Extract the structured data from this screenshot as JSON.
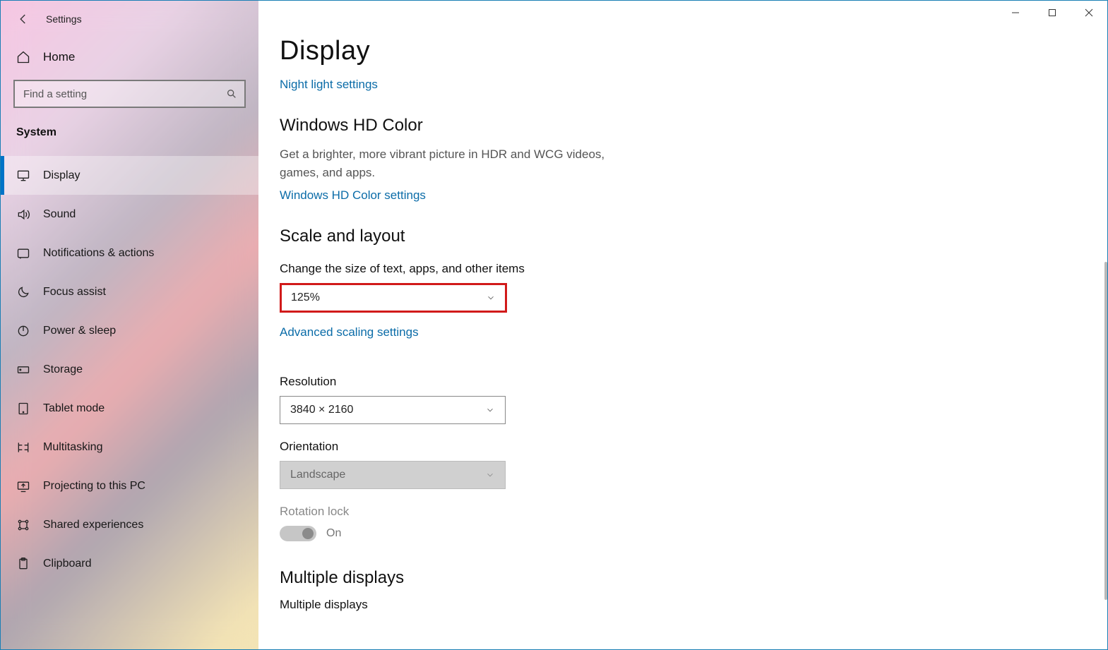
{
  "window": {
    "title": "Settings"
  },
  "sidebar": {
    "home": "Home",
    "search_placeholder": "Find a setting",
    "category": "System",
    "items": [
      {
        "id": "display",
        "label": "Display",
        "active": true
      },
      {
        "id": "sound",
        "label": "Sound",
        "active": false
      },
      {
        "id": "notif",
        "label": "Notifications & actions",
        "active": false
      },
      {
        "id": "focus",
        "label": "Focus assist",
        "active": false
      },
      {
        "id": "power",
        "label": "Power & sleep",
        "active": false
      },
      {
        "id": "storage",
        "label": "Storage",
        "active": false
      },
      {
        "id": "tablet",
        "label": "Tablet mode",
        "active": false
      },
      {
        "id": "multitask",
        "label": "Multitasking",
        "active": false
      },
      {
        "id": "projecting",
        "label": "Projecting to this PC",
        "active": false
      },
      {
        "id": "shared",
        "label": "Shared experiences",
        "active": false
      },
      {
        "id": "clipboard",
        "label": "Clipboard",
        "active": false
      }
    ]
  },
  "page": {
    "title": "Display",
    "night_light_link": "Night light settings",
    "hd_color": {
      "heading": "Windows HD Color",
      "desc": "Get a brighter, more vibrant picture in HDR and WCG videos, games, and apps.",
      "link": "Windows HD Color settings"
    },
    "scale": {
      "heading": "Scale and layout",
      "size_label": "Change the size of text, apps, and other items",
      "size_value": "125%",
      "advanced_link": "Advanced scaling settings",
      "res_label": "Resolution",
      "res_value": "3840 × 2160",
      "orient_label": "Orientation",
      "orient_value": "Landscape",
      "rotation_label": "Rotation lock",
      "rotation_state": "On"
    },
    "multi": {
      "heading": "Multiple displays",
      "sub": "Multiple displays"
    }
  }
}
